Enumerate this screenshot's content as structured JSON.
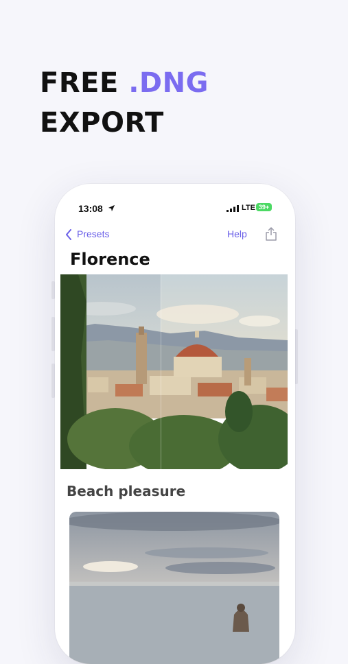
{
  "headline": {
    "part1": "FREE",
    "accent": ".DNG",
    "line2": "EXPORT"
  },
  "status_bar": {
    "time": "13:08",
    "network": "LTE",
    "battery": "39+"
  },
  "nav": {
    "back_label": "Presets",
    "help_label": "Help"
  },
  "preset_title": "Florence",
  "next_section_title": "Beach pleasure",
  "icons": [
    "location-arrow-icon",
    "signal-icon",
    "battery-icon",
    "back-chevron-icon",
    "share-icon"
  ],
  "colors": {
    "accent": "#7b6cf0",
    "link": "#6a5fe8",
    "battery": "#4cd964"
  }
}
